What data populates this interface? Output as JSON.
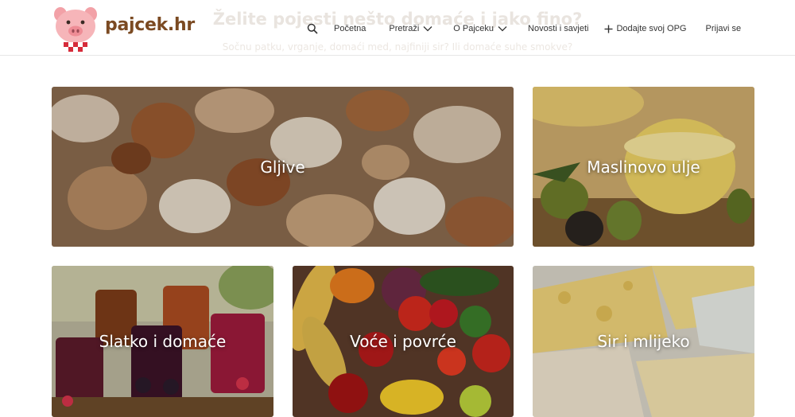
{
  "header": {
    "brand": "pajcek.hr",
    "nav": [
      {
        "label": "Početna",
        "icon": "search-icon"
      },
      {
        "label": "Pretraži",
        "icon": "chevron-down-icon"
      },
      {
        "label": "O Pajceku",
        "icon": "chevron-down-icon"
      },
      {
        "label": "Novosti i savjeti"
      },
      {
        "label": "Dodajte svoj OPG",
        "icon": "plus-icon"
      },
      {
        "label": "Prijavi se"
      }
    ]
  },
  "hero": {
    "title": "Želite pojesti nešto domaće i jako fino?",
    "subtitle": "Sočnu patku, vrganje, domaći med, najfiniji sir? Ili domaće suhe smokve?"
  },
  "categories": [
    {
      "label": "Gljive"
    },
    {
      "label": "Maslinovo ulje"
    },
    {
      "label": "Slatko i domaće"
    },
    {
      "label": "Voće i povrće"
    },
    {
      "label": "Sir i mlijeko"
    }
  ],
  "colors": {
    "brand": "#7b4a22",
    "accent": "#e6556b"
  }
}
